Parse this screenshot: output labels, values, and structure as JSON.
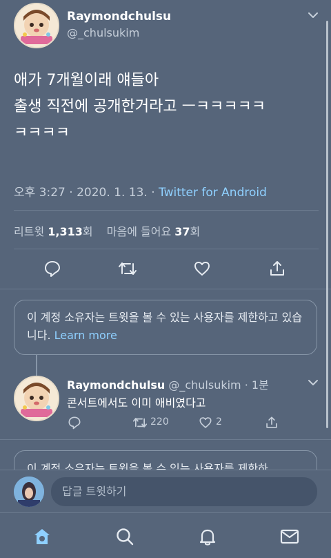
{
  "tweet": {
    "display_name": "Raymondchulsu",
    "handle": "@_chulsukim",
    "text_line1": "애가 7개월이래 얘들아",
    "text_line2": "출생 직전에 공개한거라고 ㅡㅋㅋㅋㅋㅋ",
    "text_line3": "ㅋㅋㅋㅋ",
    "time": "오후 3:27 · 2020. 1. 13. · ",
    "source": "Twitter for Android",
    "retweet_label": "리트윗 ",
    "retweet_count": "1,313",
    "retweet_unit": "회",
    "like_label": "마음에 들어요 ",
    "like_count": "37",
    "like_unit": "회"
  },
  "notice": {
    "text": "이 계정 소유자는 트윗을 볼 수 있는 사용자를 제한하고 있습니다. ",
    "learn_more": "Learn more"
  },
  "reply": {
    "display_name": "Raymondchulsu",
    "handle_time": "@_chulsukim · 1분",
    "text": "콘서트에서도 이미 애비였다고",
    "retweet_count": "220",
    "like_count": "2"
  },
  "notice2": {
    "text": "이 계정 소유자는 트윗을 볼 수 있는 사용자를 제한하"
  },
  "composer": {
    "placeholder": "답글 트윗하기"
  },
  "colors": {
    "background": "#56657a",
    "link": "#8fd0ff",
    "home_active": "#8fd0ff"
  },
  "icons": [
    "chevron-down-icon",
    "reply-icon",
    "retweet-icon",
    "heart-icon",
    "share-icon",
    "home-icon",
    "search-icon",
    "bell-icon",
    "mail-icon"
  ]
}
